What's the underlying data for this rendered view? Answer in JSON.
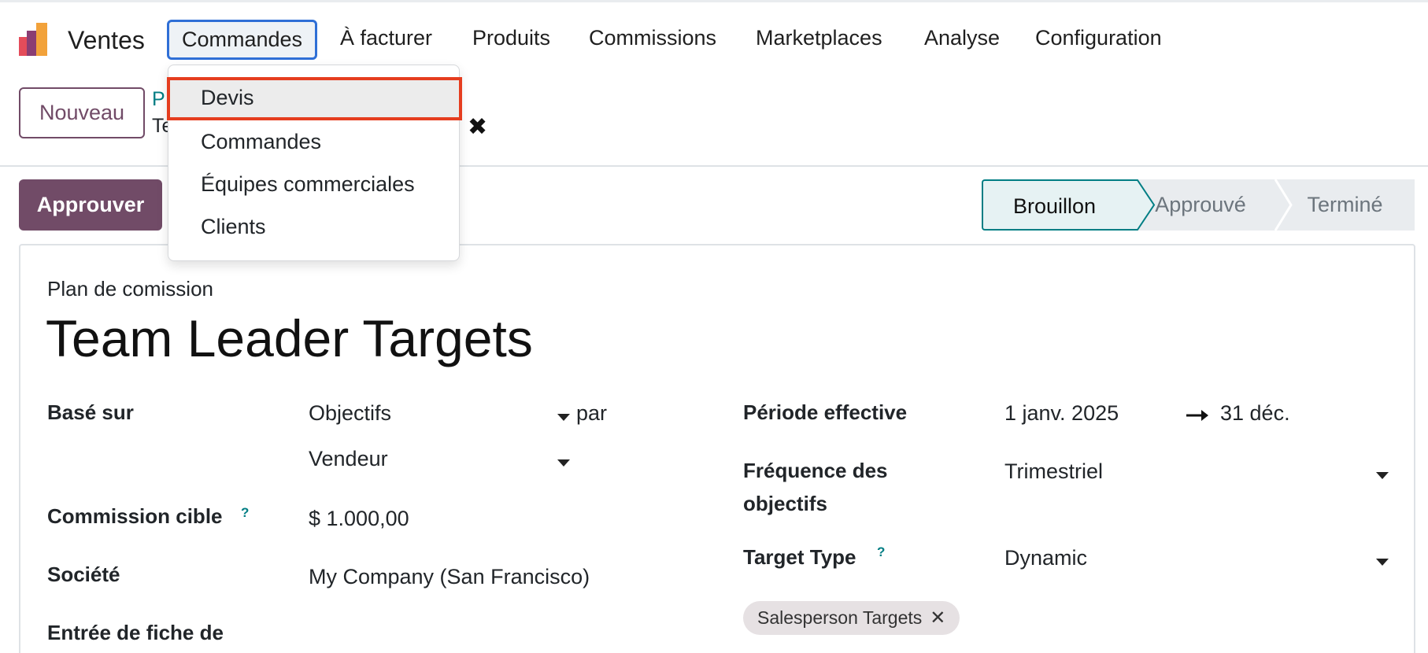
{
  "navbar": {
    "app_name": "Ventes",
    "menu": [
      "Commandes",
      "À facturer",
      "Produits",
      "Commissions",
      "Marketplaces",
      "Analyse",
      "Configuration"
    ]
  },
  "dropdown": {
    "items": [
      "Devis",
      "Commandes",
      "Équipes commerciales",
      "Clients"
    ],
    "highlighted": "Devis"
  },
  "control": {
    "new_label": "Nouveau",
    "breadcrumb_parent": "P",
    "breadcrumb_current": "Te"
  },
  "actions": {
    "approve_label": "Approuver"
  },
  "statusbar": {
    "stages": [
      "Brouillon",
      "Approuvé",
      "Terminé"
    ],
    "current": "Brouillon"
  },
  "form": {
    "record_type": "Plan de comission",
    "title": "Team Leader Targets",
    "based_on_label": "Basé sur",
    "based_on_value": "Objectifs",
    "by_label": "par",
    "by_value": "Vendeur",
    "target_commission_label": "Commission cible",
    "target_commission_value": "$ 1.000,00",
    "company_label": "Société",
    "company_value": "My Company (San Francisco)",
    "timesheet_label": "Entrée de fiche de",
    "period_label": "Période effective",
    "period_start": "1 janv. 2025",
    "period_end": "31 déc.",
    "frequency_label_1": "Fréquence des",
    "frequency_label_2": "objectifs",
    "frequency_value": "Trimestriel",
    "target_type_label": "Target Type",
    "target_type_value": "Dynamic",
    "tag": "Salesperson Targets",
    "help_mark": "?"
  },
  "colors": {
    "brand": "#714b67",
    "teal": "#017e84",
    "highlight_border": "#e53d1f",
    "active_nav_border": "#2f6fd6"
  }
}
